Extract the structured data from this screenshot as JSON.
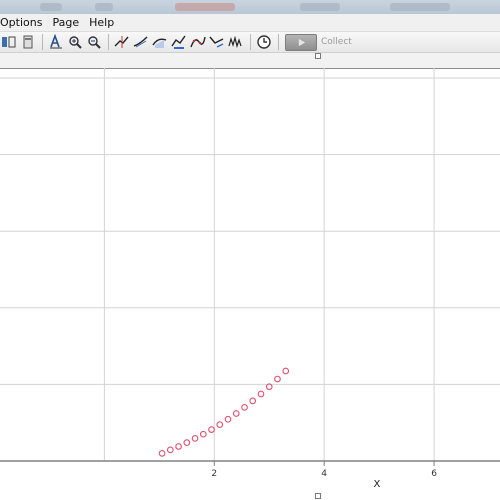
{
  "menu": {
    "items": [
      "Options",
      "Page",
      "Help"
    ]
  },
  "toolbar": {
    "tools": [
      "data-table-icon",
      "data-browser-icon",
      "autoscale-icon",
      "zoom-in-icon",
      "zoom-out-icon",
      "examine-icon",
      "tangent-icon",
      "integral-icon",
      "statistics-icon",
      "curve-fit-icon",
      "linear-fit-icon",
      "fft-icon",
      "timer-icon"
    ],
    "collect_label": "Collect"
  },
  "colors": {
    "grid": "#d3d3d3",
    "axis": "#808080",
    "marker": "#e0506e"
  },
  "chart_data": {
    "type": "scatter",
    "xlabel": "X",
    "x_ticks": [
      2,
      4,
      6
    ],
    "xlim": [
      -1.9,
      7.2
    ],
    "ylim": [
      0,
      10
    ],
    "grid": true,
    "series": [
      {
        "marker": "open-circle",
        "x": [
          1.05,
          1.2,
          1.35,
          1.5,
          1.65,
          1.8,
          1.95,
          2.1,
          2.25,
          2.4,
          2.55,
          2.7,
          2.85,
          3.0,
          3.15,
          3.3
        ],
        "y": [
          0.2,
          0.29,
          0.38,
          0.48,
          0.59,
          0.7,
          0.82,
          0.95,
          1.09,
          1.24,
          1.4,
          1.57,
          1.75,
          1.94,
          2.14,
          2.35
        ]
      }
    ]
  }
}
